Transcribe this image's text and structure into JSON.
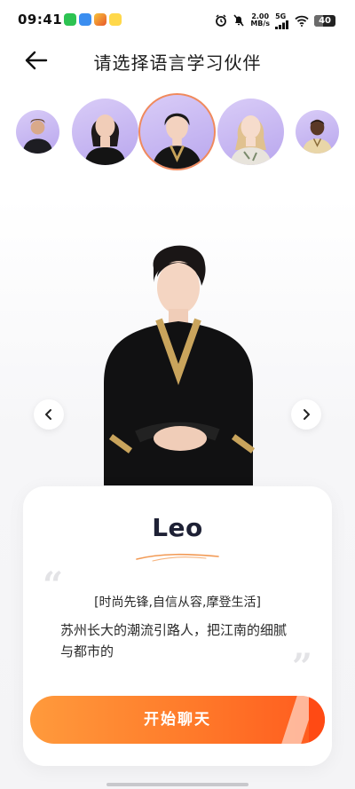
{
  "status": {
    "time": "09:41",
    "net_speed_value": "2.00",
    "net_speed_unit": "MB/s",
    "network": "5G",
    "battery": "40"
  },
  "header": {
    "back_icon": "arrow-left-icon",
    "title": "请选择语言学习伙伴"
  },
  "companion": {
    "name": "Leo",
    "tags": "[时尚先锋,自信从容,摩登生活]",
    "description": "苏州长大的潮流引路人，把江南的细腻与都市的",
    "open_quote": "“",
    "close_quote": "”"
  },
  "actions": {
    "start_chat": "开始聊天"
  },
  "colors": {
    "accent_start": "#ff9a3c",
    "accent_end": "#ff5a1e",
    "avatar_bg": "#c8b8f2",
    "selected_border": "#f08a5d"
  }
}
